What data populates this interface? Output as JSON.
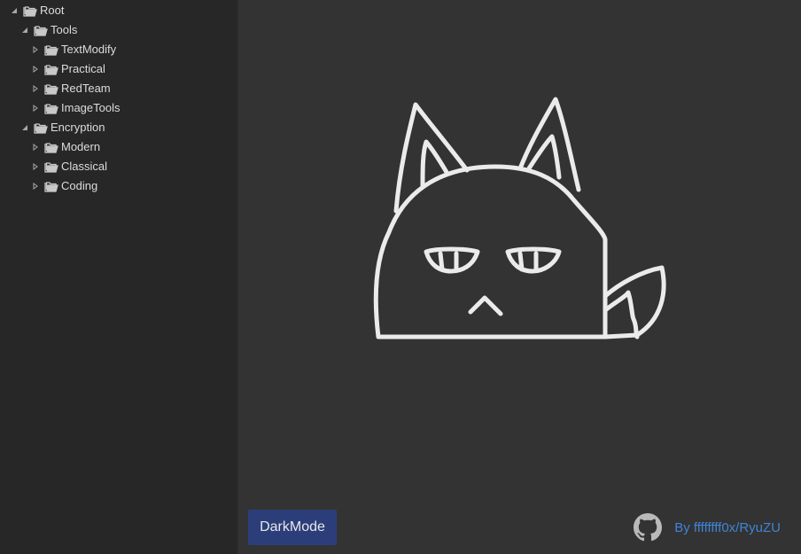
{
  "tree": {
    "root": {
      "label": "Root"
    },
    "tools": {
      "label": "Tools"
    },
    "tools_children": [
      {
        "label": "TextModify"
      },
      {
        "label": "Practical"
      },
      {
        "label": "RedTeam"
      },
      {
        "label": "ImageTools"
      }
    ],
    "encryption": {
      "label": "Encryption"
    },
    "encryption_children": [
      {
        "label": "Modern"
      },
      {
        "label": "Classical"
      },
      {
        "label": "Coding"
      }
    ]
  },
  "footer": {
    "darkmode_label": "DarkMode",
    "credit_label": "By ffffffff0x/RyuZU"
  },
  "colors": {
    "sidebar_bg": "#272727",
    "main_bg": "#333333",
    "button_bg": "#2c3e7a",
    "link": "#3f84d6",
    "folder": "#c8c8c8"
  },
  "icons": {
    "expanded": "triangle-down-icon",
    "collapsed": "triangle-right-icon",
    "folder": "folder-open-icon",
    "github": "github-icon"
  }
}
